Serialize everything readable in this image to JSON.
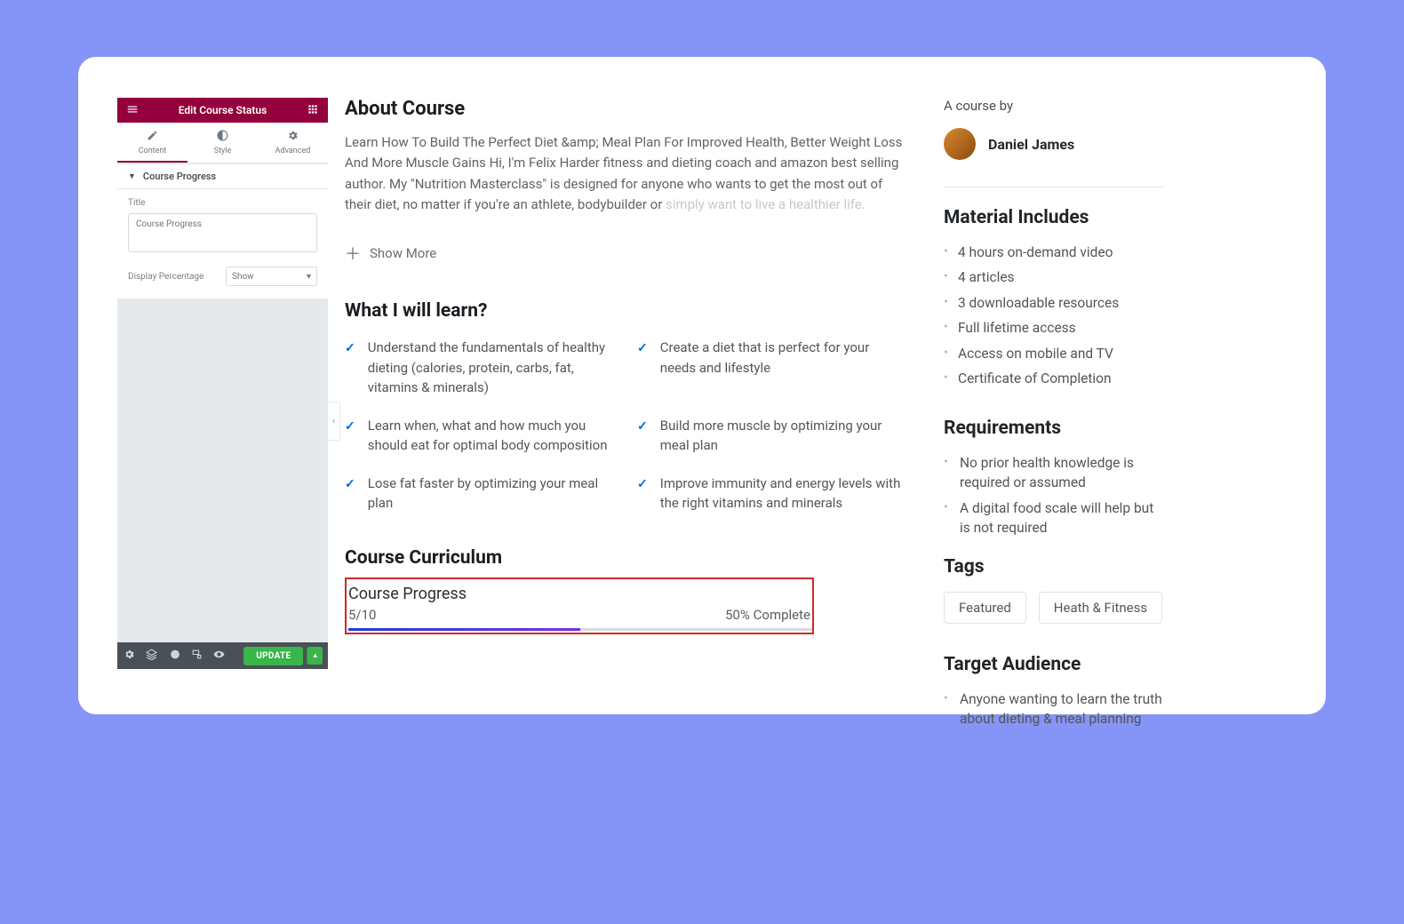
{
  "editor": {
    "header_title": "Edit Course Status",
    "tabs": {
      "content": "Content",
      "style": "Style",
      "advanced": "Advanced"
    },
    "section_label": "Course Progress",
    "title_label": "Title",
    "title_value": "Course Progress",
    "display_label": "Display Percentage",
    "display_value": "Show",
    "update_label": "UPDATE"
  },
  "about": {
    "heading": "About Course",
    "body_visible": "Learn How To Build The Perfect Diet &amp; Meal Plan For Improved Health, Better Weight Loss And More Muscle Gains Hi, I'm Felix Harder fitness and dieting coach and amazon best selling author. My \"Nutrition Masterclass\" is designed for anyone who wants to get the most out of their diet, no matter if you're an athlete, bodybuilder or ",
    "body_faded": "simply want to live a healthier life.",
    "show_more": "Show More"
  },
  "learn": {
    "heading": "What I will learn?",
    "items": [
      "Understand the fundamentals of healthy dieting (calories, protein, carbs, fat, vitamins & minerals)",
      "Create a diet that is perfect for your needs and lifestyle",
      "Learn when, what and how much you should eat for optimal body composition",
      "Build more muscle by optimizing your meal plan",
      "Lose fat faster by optimizing your meal plan",
      "Improve immunity and energy levels with the right vitamins and minerals"
    ]
  },
  "curriculum": {
    "heading": "Course Curriculum",
    "progress_title": "Course Progress",
    "count": "5/10",
    "percent_label": "50% Complete",
    "percent": 50
  },
  "aside": {
    "by_label": "A course by",
    "author": "Daniel James",
    "material_heading": "Material Includes",
    "materials": [
      "4 hours on-demand video",
      "4 articles",
      "3 downloadable resources",
      "Full lifetime access",
      "Access on mobile and TV",
      "Certificate of Completion"
    ],
    "req_heading": "Requirements",
    "requirements": [
      "No prior health knowledge is required or assumed",
      "A digital food scale will help but is not required"
    ],
    "tags_heading": "Tags",
    "tags": [
      "Featured",
      "Heath & Fitness"
    ],
    "audience_heading": "Target Audience",
    "audience": [
      "Anyone wanting to learn the truth about dieting & meal planning"
    ]
  }
}
